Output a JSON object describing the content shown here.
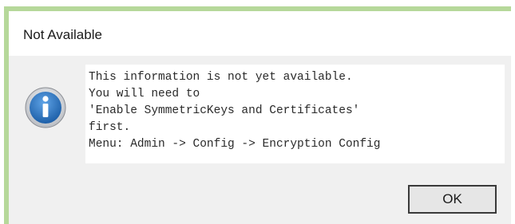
{
  "dialog": {
    "title": "Not Available",
    "message_lines": [
      "This information is not yet available.",
      "You will need to",
      "'Enable SymmetricKeys and Certificates'",
      "first.",
      "Menu: Admin -> Config -> Encryption Config"
    ],
    "icon": "info-icon",
    "ok_label": "OK"
  },
  "colors": {
    "accent_border": "#b6d89a",
    "dialog_background": "#f0f0f0",
    "icon_blue": "#2b6fb6"
  }
}
